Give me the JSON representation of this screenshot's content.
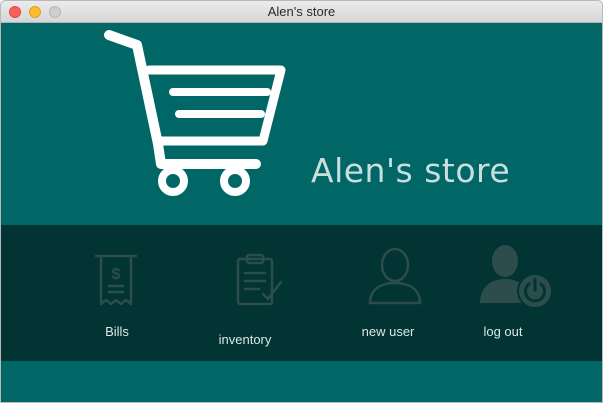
{
  "window": {
    "title": "Alen's store"
  },
  "hero": {
    "store_name": "Alen's store",
    "logo_icon": "shopping-cart-icon"
  },
  "nav": [
    {
      "id": "bills",
      "label": "Bills",
      "icon": "receipt-dollar-icon"
    },
    {
      "id": "inventory",
      "label": "inventory",
      "icon": "clipboard-check-icon"
    },
    {
      "id": "new_user",
      "label": "new user",
      "icon": "user-outline-icon"
    },
    {
      "id": "log_out",
      "label": "log out",
      "icon": "user-power-icon"
    }
  ],
  "colors": {
    "primary": "#006766",
    "nav_bar": "#013433",
    "icon_dim": "#2c4d4c",
    "text": "#dbe7e6"
  }
}
